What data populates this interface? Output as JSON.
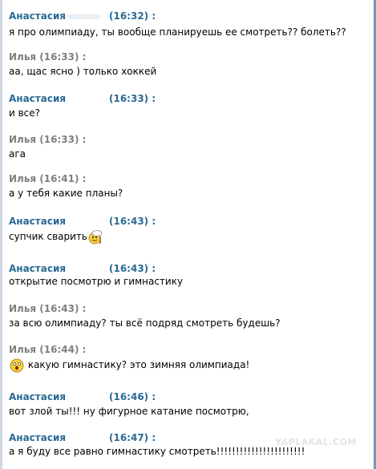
{
  "colors": {
    "self_name": "#2a6a96",
    "other_name": "#7f7f7f",
    "text": "#000000",
    "watermark": "#e4e4e4"
  },
  "messages": [
    {
      "sender": "Анастасия",
      "time": "(16:32) :",
      "text": "я про олимпиаду, ты вообще планируешь ее смотреть?? болеть??",
      "role": "self"
    },
    {
      "sender": "Илья (16:33) :",
      "time": "",
      "text": "аа, щас ясно ) только хоккей",
      "role": "other"
    },
    {
      "sender": "Анастасия",
      "time": "(16:33) :",
      "text": "и все?",
      "role": "self"
    },
    {
      "sender": "Илья (16:33) :",
      "time": "",
      "text": "ага",
      "role": "other"
    },
    {
      "sender": "Илья (16:41) :",
      "time": "",
      "text": "а у тебя какие планы?",
      "role": "other"
    },
    {
      "sender": "Анастасия",
      "time": "(16:43) :",
      "text": "супчик сварить",
      "role": "self",
      "emoticon": "chef-smiley-icon"
    },
    {
      "sender": "Анастасия",
      "time": "(16:43) :",
      "text": "открытие посмотрю и гимнастику",
      "role": "self"
    },
    {
      "sender": "Илья (16:43) :",
      "time": "",
      "text": "за всю олимпиаду? ты всё подряд смотреть будешь?",
      "role": "other"
    },
    {
      "sender": "Илья (16:44) :",
      "time": "",
      "text": "какую гимнастику? это зимняя олимпиада!",
      "role": "other",
      "emoticon": "shocked-smiley-icon"
    },
    {
      "sender": "Анастасия",
      "time": "(16:46) :",
      "text": "вот злой ты!!!  ну фигурное катание посмотрю,",
      "role": "self"
    },
    {
      "sender": "Анастасия",
      "time": "(16:47) :",
      "text": "а я буду все равно гимнастику смотреть!!!!!!!!!!!!!!!!!!!!!!!",
      "role": "self"
    }
  ],
  "watermark": "YAPLAKAL.COM"
}
